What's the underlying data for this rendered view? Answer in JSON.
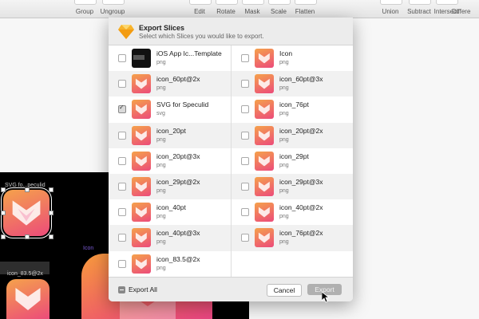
{
  "toolbar": {
    "items": [
      {
        "label": "Group"
      },
      {
        "label": "Ungroup"
      },
      {
        "label": "Edit"
      },
      {
        "label": "Rotate"
      },
      {
        "label": "Mask"
      },
      {
        "label": "Scale"
      },
      {
        "label": "Flatten"
      },
      {
        "label": "Union"
      },
      {
        "label": "Subtract"
      },
      {
        "label": "Intersect"
      },
      {
        "label": "Differe"
      }
    ]
  },
  "canvas": {
    "label_svg": "SVG fo...peculid",
    "label_icon": "Icon",
    "label_icon_83": "icon_83.5@2x"
  },
  "dialog": {
    "title": "Export Slices",
    "subtitle": "Select which Slices you would like to export.",
    "left": [
      {
        "name": "iOS App Ic...Template",
        "type": "png",
        "checked": false
      },
      {
        "name": "icon_60pt@2x",
        "type": "png",
        "checked": false
      },
      {
        "name": "SVG for Speculid",
        "type": "svg",
        "checked": true
      },
      {
        "name": "icon_20pt",
        "type": "png",
        "checked": false
      },
      {
        "name": "icon_20pt@3x",
        "type": "png",
        "checked": false
      },
      {
        "name": "icon_29pt@2x",
        "type": "png",
        "checked": false
      },
      {
        "name": "icon_40pt",
        "type": "png",
        "checked": false
      },
      {
        "name": "icon_40pt@3x",
        "type": "png",
        "checked": false
      },
      {
        "name": "icon_83.5@2x",
        "type": "png",
        "checked": false
      }
    ],
    "right": [
      {
        "name": "Icon",
        "type": "png",
        "checked": false
      },
      {
        "name": "icon_60pt@3x",
        "type": "png",
        "checked": false
      },
      {
        "name": "icon_76pt",
        "type": "png",
        "checked": false
      },
      {
        "name": "icon_20pt@2x",
        "type": "png",
        "checked": false
      },
      {
        "name": "icon_29pt",
        "type": "png",
        "checked": false
      },
      {
        "name": "icon_29pt@3x",
        "type": "png",
        "checked": false
      },
      {
        "name": "icon_40pt@2x",
        "type": "png",
        "checked": false
      },
      {
        "name": "icon_76pt@2x",
        "type": "png",
        "checked": false
      }
    ],
    "export_all_label": "Export All",
    "cancel_label": "Cancel",
    "export_label": "Export"
  }
}
